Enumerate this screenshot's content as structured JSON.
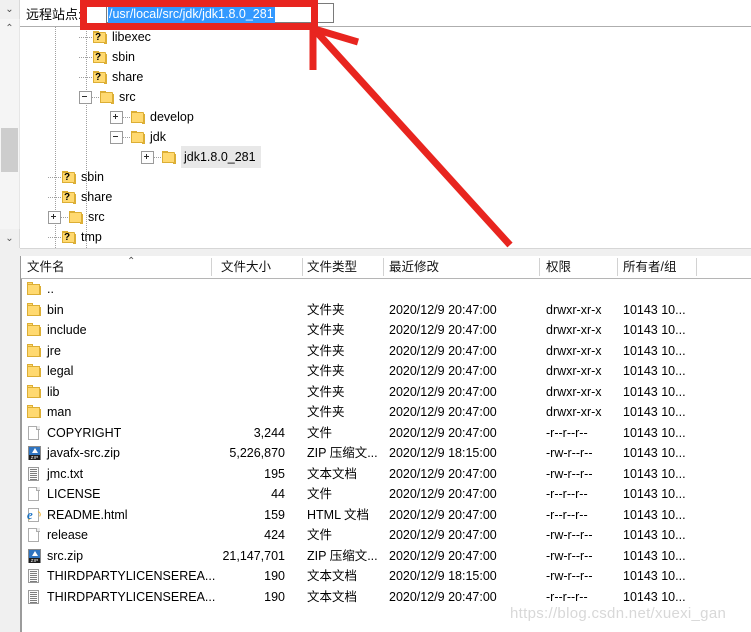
{
  "window": {
    "site_label": "远程站点:",
    "address_value": "/usr/local/src/jdk/jdk1.8.0_281"
  },
  "tree": {
    "items": [
      {
        "label": "libexec",
        "indent": 1,
        "icon": "folder-question-icon",
        "expander": "none",
        "selected": false
      },
      {
        "label": "sbin",
        "indent": 1,
        "icon": "folder-question-icon",
        "expander": "none",
        "selected": false
      },
      {
        "label": "share",
        "indent": 1,
        "icon": "folder-question-icon",
        "expander": "none",
        "selected": false
      },
      {
        "label": "src",
        "indent": 1,
        "icon": "folder-icon",
        "expander": "collapse",
        "selected": false
      },
      {
        "label": "develop",
        "indent": 2,
        "icon": "folder-icon",
        "expander": "expand",
        "selected": false
      },
      {
        "label": "jdk",
        "indent": 2,
        "icon": "folder-icon",
        "expander": "collapse",
        "selected": false
      },
      {
        "label": "jdk1.8.0_281",
        "indent": 3,
        "icon": "folder-icon",
        "expander": "expand",
        "selected": true
      },
      {
        "label": "sbin",
        "indent": 0,
        "icon": "folder-question-icon",
        "expander": "none",
        "selected": false
      },
      {
        "label": "share",
        "indent": 0,
        "icon": "folder-question-icon",
        "expander": "none",
        "selected": false
      },
      {
        "label": "src",
        "indent": 0,
        "icon": "folder-icon",
        "expander": "expand",
        "selected": false
      },
      {
        "label": "tmp",
        "indent": 0,
        "icon": "folder-question-icon",
        "expander": "none",
        "selected": false
      }
    ]
  },
  "filelist": {
    "columns": [
      {
        "key": "name",
        "label": "文件名",
        "sorted": "asc"
      },
      {
        "key": "size",
        "label": "文件大小",
        "sorted": ""
      },
      {
        "key": "type",
        "label": "文件类型",
        "sorted": ""
      },
      {
        "key": "mod",
        "label": "最近修改",
        "sorted": ""
      },
      {
        "key": "perm",
        "label": "权限",
        "sorted": ""
      },
      {
        "key": "own",
        "label": "所有者/组",
        "sorted": ""
      }
    ],
    "rows": [
      {
        "icon": "folder-icon",
        "name": "..",
        "size": "",
        "type": "",
        "mod": "",
        "perm": "",
        "own": ""
      },
      {
        "icon": "folder-icon",
        "name": "bin",
        "size": "",
        "type": "文件夹",
        "mod": "2020/12/9 20:47:00",
        "perm": "drwxr-xr-x",
        "own": "10143 10..."
      },
      {
        "icon": "folder-icon",
        "name": "include",
        "size": "",
        "type": "文件夹",
        "mod": "2020/12/9 20:47:00",
        "perm": "drwxr-xr-x",
        "own": "10143 10..."
      },
      {
        "icon": "folder-icon",
        "name": "jre",
        "size": "",
        "type": "文件夹",
        "mod": "2020/12/9 20:47:00",
        "perm": "drwxr-xr-x",
        "own": "10143 10..."
      },
      {
        "icon": "folder-icon",
        "name": "legal",
        "size": "",
        "type": "文件夹",
        "mod": "2020/12/9 20:47:00",
        "perm": "drwxr-xr-x",
        "own": "10143 10..."
      },
      {
        "icon": "folder-icon",
        "name": "lib",
        "size": "",
        "type": "文件夹",
        "mod": "2020/12/9 20:47:00",
        "perm": "drwxr-xr-x",
        "own": "10143 10..."
      },
      {
        "icon": "folder-icon",
        "name": "man",
        "size": "",
        "type": "文件夹",
        "mod": "2020/12/9 20:47:00",
        "perm": "drwxr-xr-x",
        "own": "10143 10..."
      },
      {
        "icon": "page-icon",
        "name": "COPYRIGHT",
        "size": "3,244",
        "type": "文件",
        "mod": "2020/12/9 20:47:00",
        "perm": "-r--r--r--",
        "own": "10143 10..."
      },
      {
        "icon": "zip-icon",
        "name": "javafx-src.zip",
        "size": "5,226,870",
        "type": "ZIP 压缩文...",
        "mod": "2020/12/9 18:15:00",
        "perm": "-rw-r--r--",
        "own": "10143 10..."
      },
      {
        "icon": "text-icon",
        "name": "jmc.txt",
        "size": "195",
        "type": "文本文档",
        "mod": "2020/12/9 20:47:00",
        "perm": "-rw-r--r--",
        "own": "10143 10..."
      },
      {
        "icon": "page-icon",
        "name": "LICENSE",
        "size": "44",
        "type": "文件",
        "mod": "2020/12/9 20:47:00",
        "perm": "-r--r--r--",
        "own": "10143 10..."
      },
      {
        "icon": "ie-html-icon",
        "name": "README.html",
        "size": "159",
        "type": "HTML 文档",
        "mod": "2020/12/9 20:47:00",
        "perm": "-r--r--r--",
        "own": "10143 10..."
      },
      {
        "icon": "page-icon",
        "name": "release",
        "size": "424",
        "type": "文件",
        "mod": "2020/12/9 20:47:00",
        "perm": "-rw-r--r--",
        "own": "10143 10..."
      },
      {
        "icon": "zip-icon",
        "name": "src.zip",
        "size": "21,147,701",
        "type": "ZIP 压缩文...",
        "mod": "2020/12/9 20:47:00",
        "perm": "-rw-r--r--",
        "own": "10143 10..."
      },
      {
        "icon": "text-icon",
        "name": "THIRDPARTYLICENSEREA...",
        "size": "190",
        "type": "文本文档",
        "mod": "2020/12/9 18:15:00",
        "perm": "-rw-r--r--",
        "own": "10143 10..."
      },
      {
        "icon": "text-icon",
        "name": "THIRDPARTYLICENSEREA...",
        "size": "190",
        "type": "文本文档",
        "mod": "2020/12/9 20:47:00",
        "perm": "-r--r--r--",
        "own": "10143 10..."
      }
    ]
  },
  "annotations": {
    "highlight_color": "#e8251f",
    "watermark": "https://blog.csdn.net/xuexi_gan"
  },
  "scrollbar": {
    "chevron_down": "⌄",
    "arrow_up": "⌃",
    "arrow_down": "⌄"
  }
}
